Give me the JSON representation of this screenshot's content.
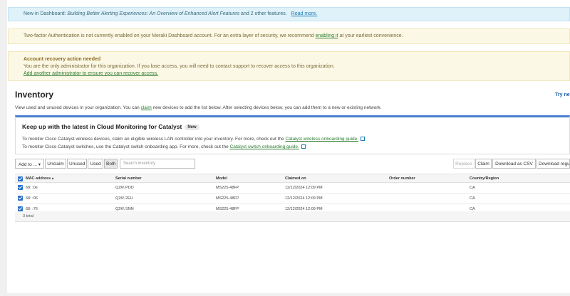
{
  "banners": {
    "news": {
      "prefix": "New in Dashboard: ",
      "article": "Building Better Alerting Experiences: An Overview of Enhanced Alert Features",
      "suffix": " and 2 other features.",
      "link": "Read more."
    },
    "two_factor": {
      "text": "Two-factor Authentication is not currently enabled on your Meraki Dashboard account. For an extra layer of security, we recommend ",
      "link": "enabling it",
      "suffix": " at your earliest convenience."
    },
    "recovery": {
      "title": "Account recovery action needed",
      "text": "You are the only administrator for this organization. If you lose access, you will need to contact support to recover access to this organization.",
      "link": "Add another administrator to ensure you can recover access."
    }
  },
  "header": {
    "title": "Inventory",
    "try_link": "Try ne"
  },
  "intro": {
    "before": "View used and unused devices in your organization. You can ",
    "link": "claim",
    "after": " new devices to add the list below. After selecting devices below, you can add them to a new or existing network."
  },
  "card": {
    "title": "Keep up with the latest in Cloud Monitoring for Catalyst",
    "badge": "New",
    "line1_before": "To monitor Cisco Catalyst wireless devices, claim an eligible wireless LAN controller into your inventory. For more, check out the ",
    "line1_link": "Catalyst wireless onboarding guide.",
    "line2_before": "To monitor Cisco Catalyst switches, use the Catalyst switch onboarding app. For more, check out the ",
    "line2_link": "Catalyst switch onboarding guide."
  },
  "toolbar": {
    "add_to": "Add to ... ▾",
    "unclaim": "Unclaim",
    "unused": "Unused",
    "used": "Used",
    "both": "Both",
    "search_placeholder": "Search inventory",
    "replace": "Replace",
    "claim": "Claim",
    "download_csv": "Download as CSV",
    "download_regular": "Download regu"
  },
  "table": {
    "columns": {
      "mac": "MAC address ▴",
      "serial": "Serial number",
      "model": "Model",
      "claimed": "Claimed on",
      "order": "Order number",
      "country": "Country/Region"
    },
    "rows": [
      {
        "mac": "68:              :0e",
        "serial": "Q2K\\          PDD",
        "model": "MS225-48FP",
        "claimed": "12/12/2024 12:09 PM",
        "order": "",
        "country": "CA"
      },
      {
        "mac": "68:              :06",
        "serial": "Q2K\\          2EU",
        "model": "MS225-48FP",
        "claimed": "12/12/2024 12:09 PM",
        "order": "",
        "country": "CA"
      },
      {
        "mac": "68:              :76",
        "serial": "Q2K\\          SNN",
        "model": "MS225-48FP",
        "claimed": "12/12/2024 12:09 PM",
        "order": "",
        "country": "CA"
      }
    ],
    "total": "3 total"
  },
  "colors": {
    "accent": "#4a7fd0",
    "link_green": "#2f7d32",
    "checkbox": "#2a6fc9"
  }
}
